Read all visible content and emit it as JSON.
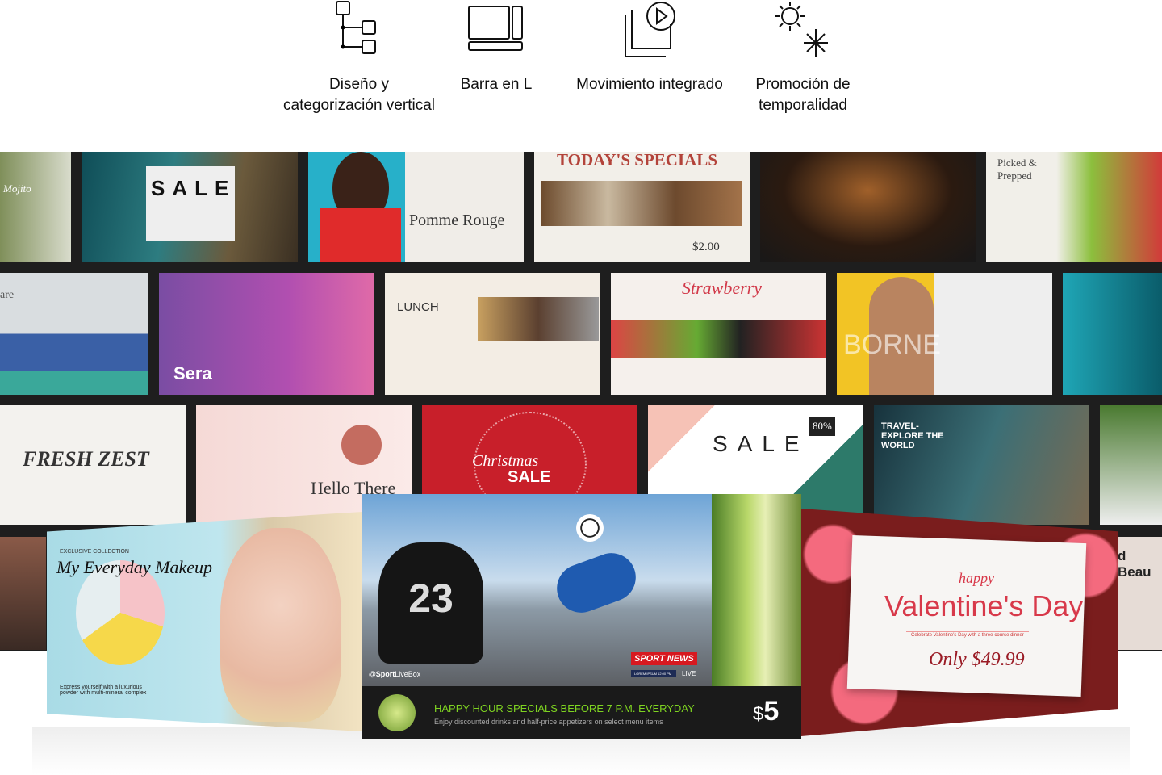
{
  "features": [
    {
      "icon": "tree-hierarchy-icon",
      "label": "Diseño y categorización vertical"
    },
    {
      "icon": "l-bar-layout-icon",
      "label": "Barra en L"
    },
    {
      "icon": "motion-play-icon",
      "label": "Movimiento integrado"
    },
    {
      "icon": "season-sun-snow-icon",
      "label": "Promoción de temporalidad"
    }
  ],
  "tiles": {
    "mojito": "Mojito",
    "sale1": "SALE",
    "pomme": "Pomme Rouge",
    "specials": "TODAY'S SPECIALS",
    "specials_price": "$2.00",
    "picked": "Picked & Prepped",
    "are": "are",
    "sera": "Sera",
    "lunch": "LUNCH",
    "strawberry": "Strawberry",
    "borne": "BORNE",
    "fresh": "FRESH ZEST",
    "hello": "Hello There",
    "christmas": "Christmas",
    "christmas_sale": "SALE",
    "sale2": "SALE",
    "sale2_badge": "80%",
    "travel": "TRAVEL- EXPLORE THE WORLD",
    "beau": "d Beau"
  },
  "makeup": {
    "eyebrow": "EXCLUSIVE COLLECTION",
    "title": "My Everyday Makeup",
    "body": "Express yourself with a luxurious powder with multi-mineral complex"
  },
  "sport": {
    "handle_bold": "@Sport",
    "handle": "LiveBox",
    "news": "SPORT NEWS",
    "ticker": "LOREM IPSUM   12:00 PM",
    "live": "LIVE",
    "jersey": "23",
    "headline": "HAPPY HOUR SPECIALS BEFORE 7 P.M. EVERYDAY",
    "sub": "Enjoy discounted drinks and half-price appetizers on select menu items",
    "currency": "$",
    "price": "5"
  },
  "valentine": {
    "happy": "happy",
    "title": "Valentine's Day",
    "sub": "Celebrate Valentine's Day with a three-course dinner",
    "price": "Only $49.99"
  },
  "colors": {
    "band": "#1e1e1e",
    "headline_green": "#7ed321",
    "valentine_red": "#d8394a",
    "sport_red": "#d71920"
  }
}
